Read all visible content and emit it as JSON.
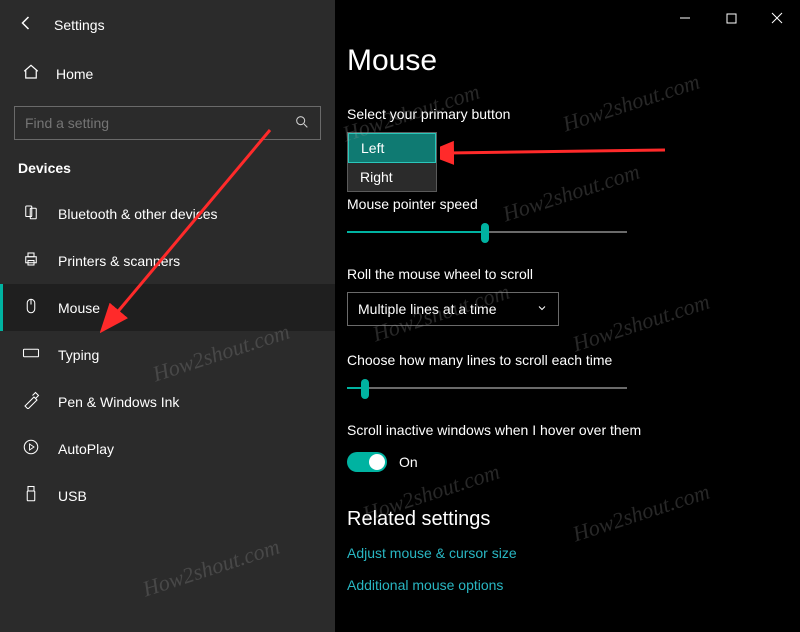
{
  "window": {
    "title": "Settings"
  },
  "sidebar": {
    "home": "Home",
    "search_placeholder": "Find a setting",
    "section": "Devices",
    "items": [
      {
        "label": "Bluetooth & other devices"
      },
      {
        "label": "Printers & scanners"
      },
      {
        "label": "Mouse"
      },
      {
        "label": "Typing"
      },
      {
        "label": "Pen & Windows Ink"
      },
      {
        "label": "AutoPlay"
      },
      {
        "label": "USB"
      }
    ]
  },
  "main": {
    "title": "Mouse",
    "primary_label": "Select your primary button",
    "primary_options": {
      "left": "Left",
      "right": "Right"
    },
    "speed_label": "Mouse pointer speed",
    "roll_label": "Roll the mouse wheel to scroll",
    "roll_value": "Multiple lines at a time",
    "lines_label": "Choose how many lines to scroll each time",
    "inactive_label": "Scroll inactive windows when I hover over them",
    "toggle_state": "On",
    "related_heading": "Related settings",
    "link1": "Adjust mouse & cursor size",
    "link2": "Additional mouse options"
  },
  "accent": "#00b3a1",
  "watermark_text": "How2shout.com"
}
